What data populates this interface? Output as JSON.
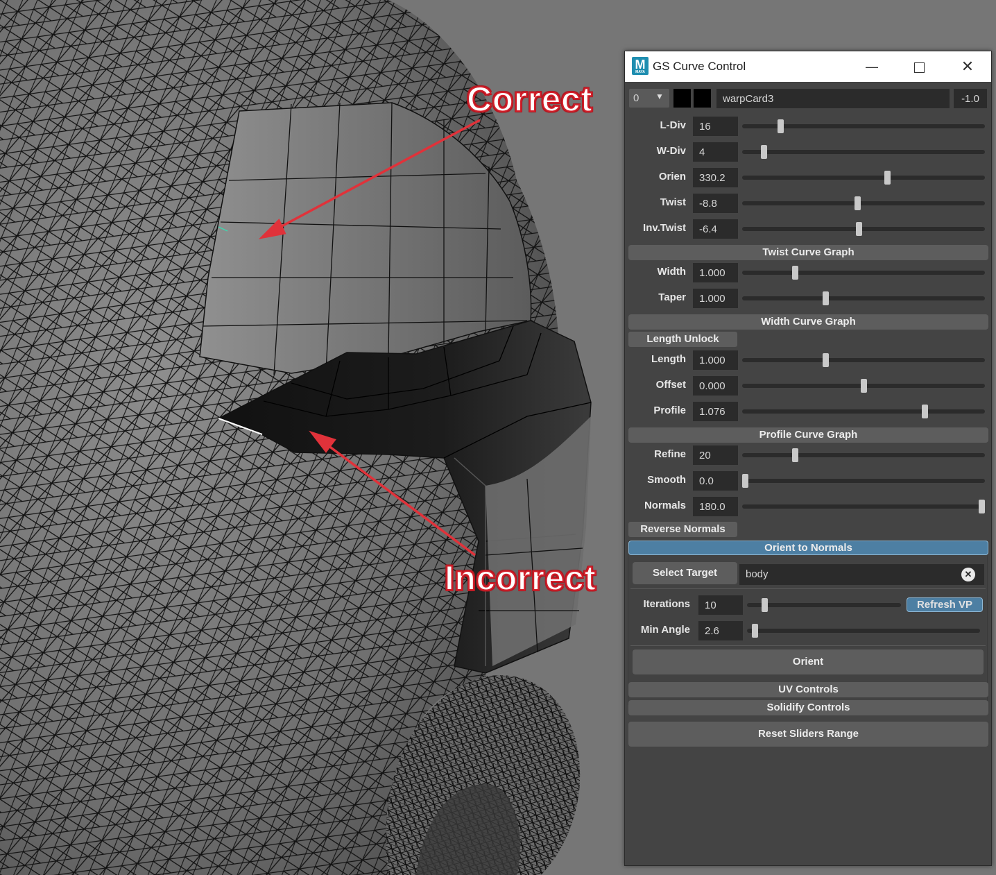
{
  "annotations": {
    "correct": "Correct",
    "incorrect": "Incorrect"
  },
  "window": {
    "title": "GS Curve Control",
    "icon_letter": "M",
    "icon_sub": "MAYA"
  },
  "header": {
    "layer": "0",
    "name": "warpCard3",
    "value": "-1.0"
  },
  "sliders_top": [
    {
      "label": "L-Div",
      "value": "16",
      "pos": 0.15
    },
    {
      "label": "W-Div",
      "value": "4",
      "pos": 0.08
    },
    {
      "label": "Orien",
      "value": "330.2",
      "pos": 0.6
    },
    {
      "label": "Twist",
      "value": "-8.8",
      "pos": 0.475
    },
    {
      "label": "Inv.Twist",
      "value": "-6.4",
      "pos": 0.48
    }
  ],
  "twist_graph": "Twist Curve Graph",
  "sliders_width": [
    {
      "label": "Width",
      "value": "1.000",
      "pos": 0.21
    },
    {
      "label": "Taper",
      "value": "1.000",
      "pos": 0.34
    }
  ],
  "width_graph": "Width Curve Graph",
  "length_unlock": "Length Unlock",
  "sliders_length": [
    {
      "label": "Length",
      "value": "1.000",
      "pos": 0.34
    },
    {
      "label": "Offset",
      "value": "0.000",
      "pos": 0.5
    },
    {
      "label": "Profile",
      "value": "1.076",
      "pos": 0.76
    }
  ],
  "profile_graph": "Profile Curve Graph",
  "sliders_refine": [
    {
      "label": "Refine",
      "value": "20",
      "pos": 0.21
    },
    {
      "label": "Smooth",
      "value": "0.0",
      "pos": 0.0
    },
    {
      "label": "Normals",
      "value": "180.0",
      "pos": 1.0
    }
  ],
  "reverse_normals": "Reverse Normals",
  "orient": {
    "header": "Orient to Normals",
    "select_target": "Select Target",
    "target_value": "body",
    "iterations_label": "Iterations",
    "iterations_value": "10",
    "iterations_pos": 0.1,
    "refresh": "Refresh VP",
    "min_angle_label": "Min Angle",
    "min_angle_value": "2.6",
    "min_angle_pos": 0.02,
    "orient_button": "Orient"
  },
  "uv_controls": "UV Controls",
  "solidify_controls": "Solidify Controls",
  "reset_sliders": "Reset Sliders Range",
  "colors": {
    "accent": "#4d7fa3",
    "panel": "#444444",
    "field": "#2b2b2b"
  }
}
